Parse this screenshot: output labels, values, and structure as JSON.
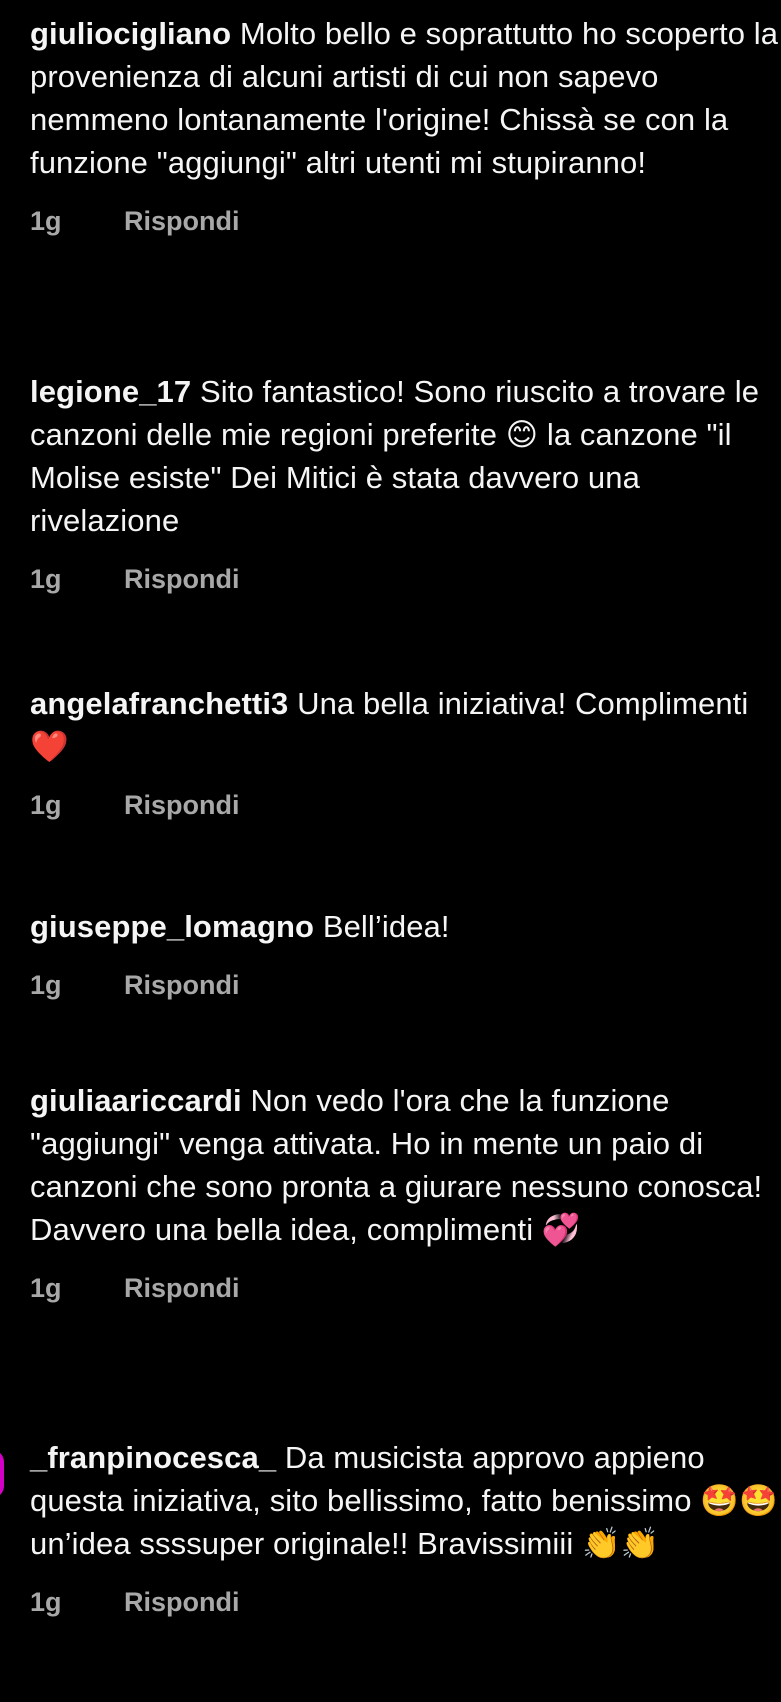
{
  "comments": [
    {
      "username": "giuliocigliano",
      "text": "Molto bello e soprattutto ho scoperto la provenienza di alcuni artisti di cui non sapevo nemmeno lontanamente l'origine! Chissà se con la funzione \"aggiungi\" altri utenti mi stupiranno!",
      "time": "1g",
      "reply_label": "Rispondi"
    },
    {
      "username": "legione_17",
      "text": "Sito fantastico! Sono riuscito a trovare le canzoni delle mie regioni preferite 😊 la canzone \"il Molise esiste\" Dei Mitici è stata davvero una rivelazione",
      "time": "1g",
      "reply_label": "Rispondi"
    },
    {
      "username": "angelafranchetti3",
      "text": "Una bella iniziativa! Complimenti ❤️",
      "time": "1g",
      "reply_label": "Rispondi"
    },
    {
      "username": "giuseppe_lomagno",
      "text": "Bell’idea!",
      "time": "1g",
      "reply_label": "Rispondi"
    },
    {
      "username": "giuliaariccardi",
      "text": "Non vedo l'ora che la funzione \"aggiungi\" venga attivata. Ho in mente un paio di canzoni che  sono pronta a giurare nessuno conosca! Davvero una bella idea, complimenti 💞",
      "time": "1g",
      "reply_label": "Rispondi"
    },
    {
      "username": "_franpinocesca_",
      "text": "Da musicista approvo appieno questa iniziativa, sito bellissimo, fatto benissimo 🤩🤩 un’idea ssssuper originale!! Bravissimiii 👏👏",
      "time": "1g",
      "reply_label": "Rispondi"
    }
  ],
  "colors": {
    "background": "#000000",
    "text": "#f5f5f5",
    "meta": "#a8a8a8",
    "story_ring": "#d300c5"
  }
}
